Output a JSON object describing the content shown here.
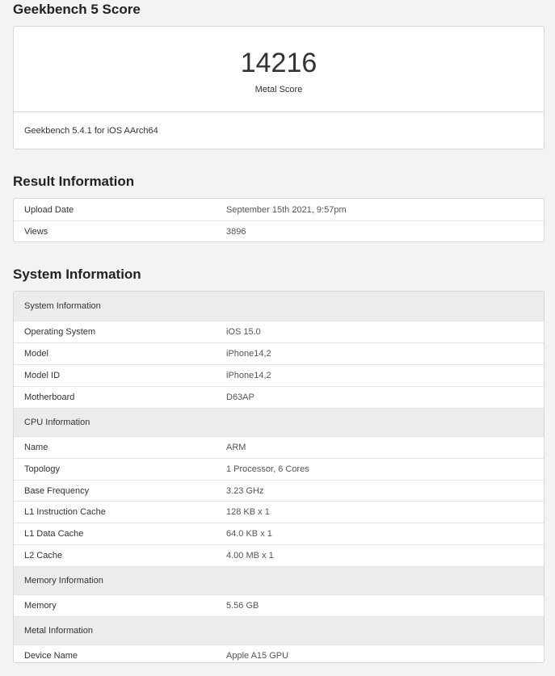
{
  "score_section": {
    "title": "Geekbench 5 Score",
    "score": "14216",
    "score_label": "Metal Score",
    "version": "Geekbench 5.4.1 for iOS AArch64"
  },
  "result_section": {
    "title": "Result Information",
    "rows": [
      {
        "key": "Upload Date",
        "value": "September 15th 2021, 9:57pm"
      },
      {
        "key": "Views",
        "value": "3896"
      }
    ]
  },
  "system_section": {
    "title": "System Information",
    "groups": [
      {
        "heading": "System Information",
        "rows": [
          {
            "key": "Operating System",
            "value": "iOS 15.0"
          },
          {
            "key": "Model",
            "value": "iPhone14,2"
          },
          {
            "key": "Model ID",
            "value": "iPhone14,2"
          },
          {
            "key": "Motherboard",
            "value": "D63AP"
          }
        ]
      },
      {
        "heading": "CPU Information",
        "rows": [
          {
            "key": "Name",
            "value": "ARM"
          },
          {
            "key": "Topology",
            "value": "1 Processor, 6 Cores"
          },
          {
            "key": "Base Frequency",
            "value": "3.23 GHz"
          },
          {
            "key": "L1 Instruction Cache",
            "value": "128 KB x 1"
          },
          {
            "key": "L1 Data Cache",
            "value": "64.0 KB x 1"
          },
          {
            "key": "L2 Cache",
            "value": "4.00 MB x 1"
          }
        ]
      },
      {
        "heading": "Memory Information",
        "rows": [
          {
            "key": "Memory",
            "value": "5.56 GB"
          }
        ]
      },
      {
        "heading": "Metal Information",
        "rows": [
          {
            "key": "Device Name",
            "value": "Apple A15 GPU"
          }
        ]
      }
    ]
  }
}
